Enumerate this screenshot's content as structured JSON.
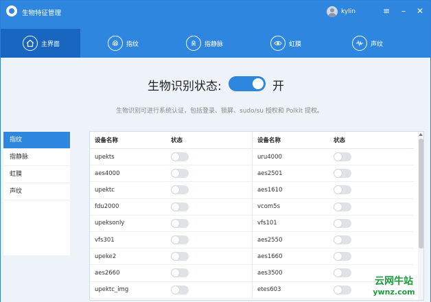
{
  "titlebar": {
    "app_title": "生物特征管理",
    "username": "kylin"
  },
  "nav": {
    "tabs": [
      {
        "label": "主界面",
        "icon": "home-icon"
      },
      {
        "label": "指纹",
        "icon": "fingerprint-icon"
      },
      {
        "label": "指静脉",
        "icon": "finger-vein-icon"
      },
      {
        "label": "虹膜",
        "icon": "iris-icon"
      },
      {
        "label": "声纹",
        "icon": "voiceprint-icon"
      }
    ]
  },
  "main": {
    "status_label": "生物识别状态:",
    "status_value": "开",
    "status_on": true,
    "description": "生物识别可进行系统认证，包括登录、锁屏、sudo/su 授权和 Polkit 提权。"
  },
  "sidebar": {
    "items": [
      {
        "label": "指纹",
        "active": true
      },
      {
        "label": "指静脉",
        "active": false
      },
      {
        "label": "虹膜",
        "active": false
      },
      {
        "label": "声纹",
        "active": false
      }
    ]
  },
  "table": {
    "header_name": "设备名称",
    "header_state": "状态",
    "left_rows": [
      "upekts",
      "aes4000",
      "upektc",
      "fdu2000",
      "upeksonly",
      "vfs301",
      "upeke2",
      "aes2660",
      "upektc_img"
    ],
    "right_rows": [
      "uru4000",
      "aes2501",
      "aes1610",
      "vcom5s",
      "vfs101",
      "aes2550",
      "aes1660",
      "aes3500",
      "etes603"
    ]
  },
  "watermark": {
    "line1": "云网牛站",
    "line2": "ywnz.com"
  },
  "colors": {
    "accent": "#2e86de",
    "active_tab": "#1866c0"
  }
}
